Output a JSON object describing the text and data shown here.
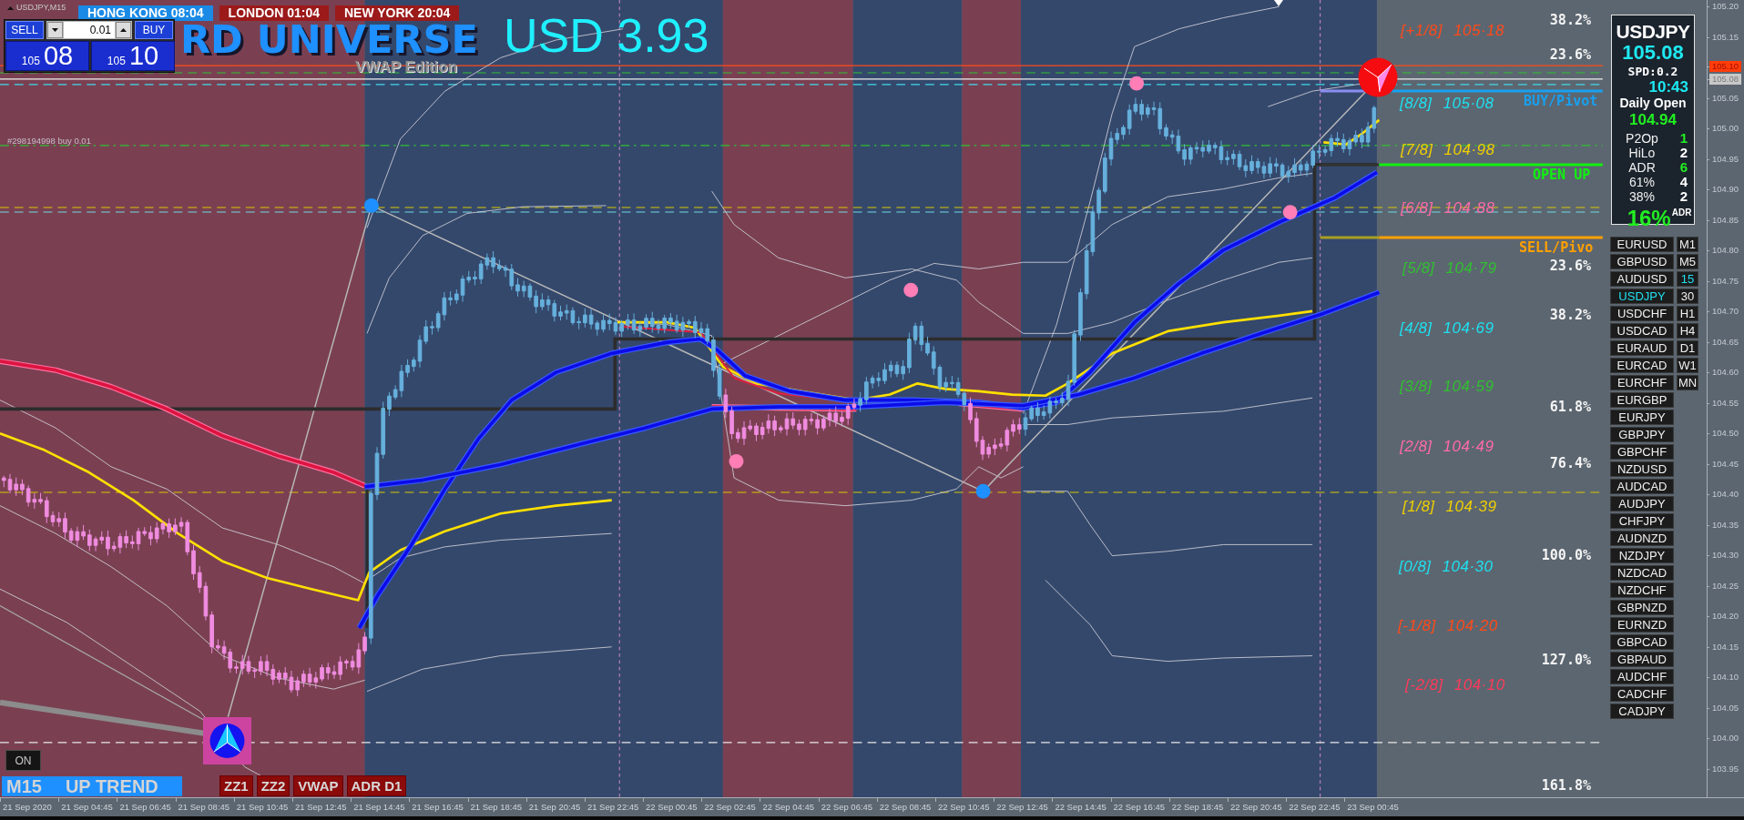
{
  "chart": {
    "symbol": "USDJPY,M15",
    "order_label": "#298194998 buy 0.01"
  },
  "sessions": [
    {
      "label": "HONG KONG 08:04",
      "active": true
    },
    {
      "label": "LONDON 01:04",
      "active": false
    },
    {
      "label": "NEW YORK 20:04",
      "active": false
    }
  ],
  "trade_panel": {
    "sell": "SELL",
    "buy": "BUY",
    "lot": "0.01",
    "bid": {
      "handle": "105",
      "pips": "08"
    },
    "ask": {
      "handle": "105",
      "pips": "10"
    }
  },
  "logo": {
    "title": "RD UNIVERSE",
    "subtitle": "VWAP Edition"
  },
  "profit": "USD 3.93",
  "murrey_levels": [
    {
      "level": "[+1/8]",
      "price": "105·18",
      "color": "#ff4a1a"
    },
    {
      "level": "[8/8]",
      "price": "105·08",
      "color": "#1ee0f0"
    },
    {
      "level": "[7/8]",
      "price": "104·98",
      "color": "#f0d000"
    },
    {
      "level": "[6/8]",
      "price": "104·88",
      "color": "#ff6aa8"
    },
    {
      "level": "[5/8]",
      "price": "104·79",
      "color": "#30c030"
    },
    {
      "level": "[4/8]",
      "price": "104·69",
      "color": "#1ee0f0"
    },
    {
      "level": "[3/8]",
      "price": "104·59",
      "color": "#30c030"
    },
    {
      "level": "[2/8]",
      "price": "104·49",
      "color": "#ff6aa8"
    },
    {
      "level": "[1/8]",
      "price": "104·39",
      "color": "#f0d000"
    },
    {
      "level": "[0/8]",
      "price": "104·30",
      "color": "#1ee0f0"
    },
    {
      "level": "[-1/8]",
      "price": "104·20",
      "color": "#ff4a1a"
    },
    {
      "level": "[-2/8]",
      "price": "104·10",
      "color": "#ff3a5a"
    }
  ],
  "retracement_labels": [
    "38.2%",
    "23.6%",
    "23.6%",
    "38.2%",
    "61.8%",
    "76.4%",
    "100.0%",
    "127.0%",
    "161.8%"
  ],
  "pivot_labels": [
    {
      "text": "BUY/Pivot",
      "color": "#18a0f0"
    },
    {
      "text": "OPEN UP",
      "color": "#10f010"
    },
    {
      "text": "SELL/Pivo",
      "color": "#ffa000"
    }
  ],
  "info_panel": {
    "symbol": "USDJPY",
    "price": "105.08",
    "spread": "SPD:0.2",
    "time": "10:43",
    "daily_open_label": "Daily Open",
    "daily_open": "104.94",
    "stats": [
      {
        "label": "P2Op",
        "value": "1",
        "color": "#22ee22"
      },
      {
        "label": "HiLo",
        "value": "2",
        "color": "#ffffff"
      },
      {
        "label": "ADR",
        "value": "6",
        "color": "#22ee22"
      },
      {
        "label": "61%",
        "value": "4",
        "color": "#ffffff"
      },
      {
        "label": "38%",
        "value": "2",
        "color": "#ffffff"
      }
    ],
    "adr_percent": "16%",
    "adr_suffix": "ADR"
  },
  "pairs": [
    {
      "symbol": "EURUSD",
      "selected": false
    },
    {
      "symbol": "GBPUSD",
      "selected": false
    },
    {
      "symbol": "AUDUSD",
      "selected": false
    },
    {
      "symbol": "USDJPY",
      "selected": true
    },
    {
      "symbol": "USDCHF",
      "selected": false
    },
    {
      "symbol": "USDCAD",
      "selected": false
    },
    {
      "symbol": "EURAUD",
      "selected": false
    },
    {
      "symbol": "EURCAD",
      "selected": false
    },
    {
      "symbol": "EURCHF",
      "selected": false
    },
    {
      "symbol": "EURGBP",
      "selected": false
    },
    {
      "symbol": "EURJPY",
      "selected": false
    },
    {
      "symbol": "GBPJPY",
      "selected": false
    },
    {
      "symbol": "GBPCHF",
      "selected": false
    },
    {
      "symbol": "NZDUSD",
      "selected": false
    },
    {
      "symbol": "AUDCAD",
      "selected": false
    },
    {
      "symbol": "AUDJPY",
      "selected": false
    },
    {
      "symbol": "CHFJPY",
      "selected": false
    },
    {
      "symbol": "AUDNZD",
      "selected": false
    },
    {
      "symbol": "NZDJPY",
      "selected": false
    },
    {
      "symbol": "NZDCAD",
      "selected": false
    },
    {
      "symbol": "NZDCHF",
      "selected": false
    },
    {
      "symbol": "GBPNZD",
      "selected": false
    },
    {
      "symbol": "EURNZD",
      "selected": false
    },
    {
      "symbol": "GBPCAD",
      "selected": false
    },
    {
      "symbol": "GBPAUD",
      "selected": false
    },
    {
      "symbol": "AUDCHF",
      "selected": false
    },
    {
      "symbol": "CADCHF",
      "selected": false
    },
    {
      "symbol": "CADJPY",
      "selected": false
    }
  ],
  "timeframes": [
    {
      "label": "M1",
      "selected": false
    },
    {
      "label": "M5",
      "selected": false
    },
    {
      "label": "15",
      "selected": true
    },
    {
      "label": "30",
      "selected": false
    },
    {
      "label": "H1",
      "selected": false
    },
    {
      "label": "H4",
      "selected": false
    },
    {
      "label": "D1",
      "selected": false
    },
    {
      "label": "W1",
      "selected": false
    },
    {
      "label": "MN",
      "selected": false
    }
  ],
  "bottom_controls": {
    "toggle": "ON",
    "trend": {
      "timeframe": "M15",
      "direction": "UP TREND"
    },
    "buttons": [
      "ZZ1",
      "ZZ2",
      "VWAP",
      "ADR D1"
    ]
  },
  "price_axis": [
    {
      "price": "105.20",
      "kind": "tick"
    },
    {
      "price": "105.15",
      "kind": "tick"
    },
    {
      "price": "105.10",
      "kind": "ask"
    },
    {
      "price": "105.08",
      "kind": "bid"
    },
    {
      "price": "105.05",
      "kind": "tick"
    },
    {
      "price": "105.00",
      "kind": "tick"
    },
    {
      "price": "104.95",
      "kind": "tick"
    },
    {
      "price": "104.90",
      "kind": "tick"
    },
    {
      "price": "104.85",
      "kind": "tick"
    },
    {
      "price": "104.80",
      "kind": "tick"
    },
    {
      "price": "104.75",
      "kind": "tick"
    },
    {
      "price": "104.70",
      "kind": "tick"
    },
    {
      "price": "104.65",
      "kind": "tick"
    },
    {
      "price": "104.60",
      "kind": "tick"
    },
    {
      "price": "104.55",
      "kind": "tick"
    },
    {
      "price": "104.50",
      "kind": "tick"
    },
    {
      "price": "104.45",
      "kind": "tick"
    },
    {
      "price": "104.40",
      "kind": "tick"
    },
    {
      "price": "104.35",
      "kind": "tick"
    },
    {
      "price": "104.30",
      "kind": "tick"
    },
    {
      "price": "104.25",
      "kind": "tick"
    },
    {
      "price": "104.20",
      "kind": "tick"
    },
    {
      "price": "104.15",
      "kind": "tick"
    },
    {
      "price": "104.10",
      "kind": "tick"
    },
    {
      "price": "104.05",
      "kind": "tick"
    },
    {
      "price": "104.00",
      "kind": "tick"
    },
    {
      "price": "103.95",
      "kind": "tick"
    }
  ],
  "time_axis": [
    "21 Sep 2020",
    "21 Sep 04:45",
    "21 Sep 06:45",
    "21 Sep 08:45",
    "21 Sep 10:45",
    "21 Sep 12:45",
    "21 Sep 14:45",
    "21 Sep 16:45",
    "21 Sep 18:45",
    "21 Sep 20:45",
    "21 Sep 22:45",
    "22 Sep 00:45",
    "22 Sep 02:45",
    "22 Sep 04:45",
    "22 Sep 06:45",
    "22 Sep 08:45",
    "22 Sep 10:45",
    "22 Sep 12:45",
    "22 Sep 14:45",
    "22 Sep 16:45",
    "22 Sep 18:45",
    "22 Sep 20:45",
    "22 Sep 22:45",
    "23 Sep 00:45"
  ]
}
